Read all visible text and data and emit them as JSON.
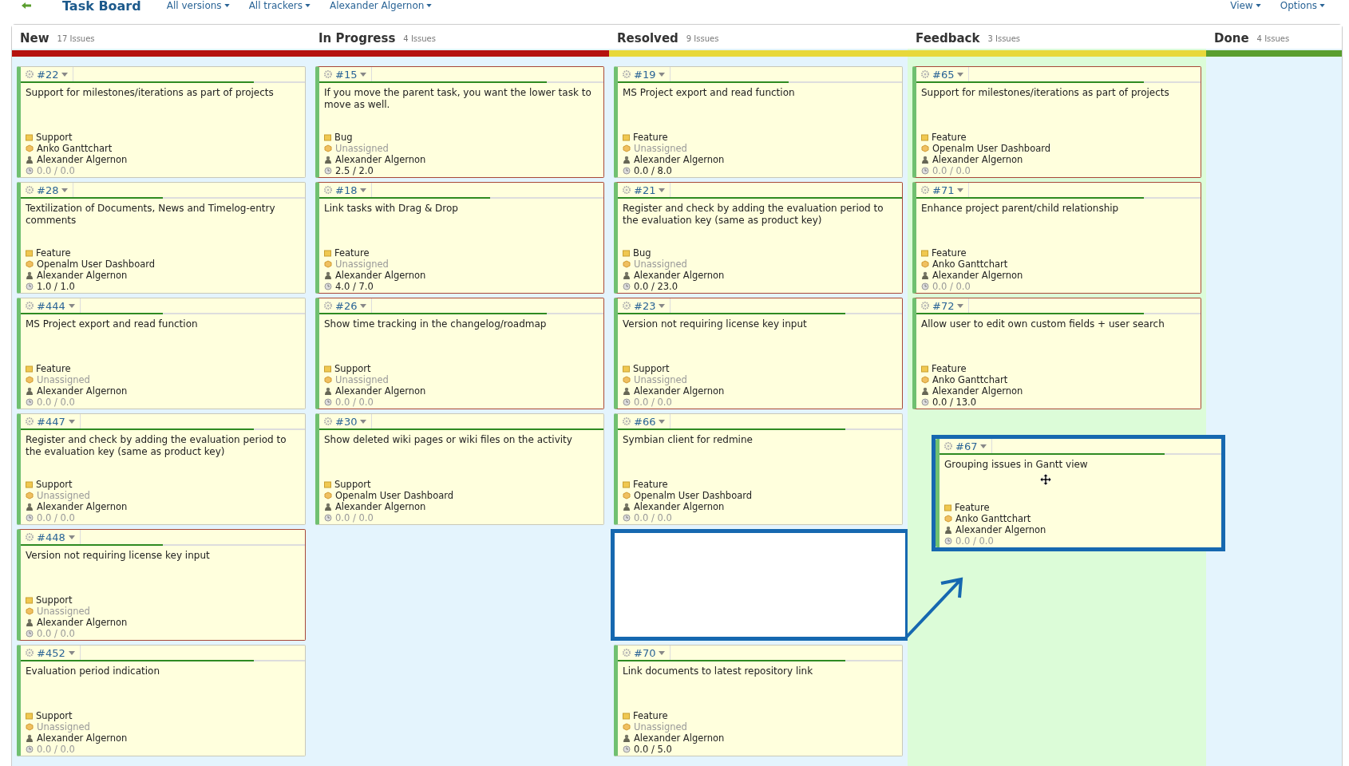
{
  "toolbar": {
    "title": "Task Board",
    "filters": [
      "All versions",
      "All trackers",
      "Alexander Algernon"
    ],
    "menus": [
      "View",
      "Options"
    ]
  },
  "columns": [
    {
      "name": "New",
      "count": "17 Issues",
      "color": "#b5130f",
      "drop_target": false,
      "cards": [
        {
          "kind": "card",
          "id": "#22",
          "level": 0.82,
          "title": "Support for milestones/iterations as part of projects",
          "tracker": "Support",
          "category": "Anko Ganttchart",
          "unassigned": false,
          "assignee": "Alexander Algernon",
          "hours": "0.0 / 0.0",
          "hours_zero": true,
          "flagged": false
        },
        {
          "kind": "card",
          "id": "#28",
          "level": 0.5,
          "title": "Textilization of Documents, News and Timelog-entry comments",
          "tracker": "Feature",
          "category": "Openalm User Dashboard",
          "unassigned": false,
          "assignee": "Alexander Algernon",
          "hours": "1.0 / 1.0",
          "hours_zero": false,
          "flagged": false
        },
        {
          "kind": "card",
          "id": "#444",
          "level": 0.5,
          "title": "MS Project export and read function",
          "tracker": "Feature",
          "category": "Unassigned",
          "unassigned": true,
          "assignee": "Alexander Algernon",
          "hours": "0.0 / 0.0",
          "hours_zero": true,
          "flagged": false
        },
        {
          "kind": "card",
          "id": "#447",
          "level": 0.82,
          "title": "Register and check by adding the evaluation period to the evaluation key (same as product key)",
          "tracker": "Support",
          "category": "Unassigned",
          "unassigned": true,
          "assignee": "Alexander Algernon",
          "hours": "0.0 / 0.0",
          "hours_zero": true,
          "flagged": false
        },
        {
          "kind": "card",
          "id": "#448",
          "level": 0.5,
          "title": "Version not requiring license key input",
          "tracker": "Support",
          "category": "Unassigned",
          "unassigned": true,
          "assignee": "Alexander Algernon",
          "hours": "0.0 / 0.0",
          "hours_zero": true,
          "flagged": true
        },
        {
          "kind": "card",
          "id": "#452",
          "level": 0.82,
          "title": "Evaluation period indication",
          "tracker": "Support",
          "category": "Unassigned",
          "unassigned": true,
          "assignee": "Alexander Algernon",
          "hours": "0.0 / 0.0",
          "hours_zero": true,
          "flagged": false
        }
      ]
    },
    {
      "name": "In Progress",
      "count": "4 Issues",
      "color": "#b5130f",
      "drop_target": false,
      "cards": [
        {
          "kind": "card",
          "id": "#15",
          "level": 0.8,
          "title": "If you move the parent task, you want the lower task to move as well.",
          "tracker": "Bug",
          "category": "Unassigned",
          "unassigned": true,
          "assignee": "Alexander Algernon",
          "hours": "2.5 / 2.0",
          "hours_zero": false,
          "flagged": true
        },
        {
          "kind": "card",
          "id": "#18",
          "level": 0.6,
          "title": "Link tasks with Drag & Drop",
          "tracker": "Feature",
          "category": "Unassigned",
          "unassigned": true,
          "assignee": "Alexander Algernon",
          "hours": "4.0 / 7.0",
          "hours_zero": false,
          "flagged": true
        },
        {
          "kind": "card",
          "id": "#26",
          "level": 0.8,
          "title": "Show time tracking in the changelog/roadmap",
          "tracker": "Support",
          "category": "Unassigned",
          "unassigned": true,
          "assignee": "Alexander Algernon",
          "hours": "0.0 / 0.0",
          "hours_zero": true,
          "flagged": true
        },
        {
          "kind": "card",
          "id": "#30",
          "level": 1.0,
          "title": "Show deleted wiki pages or wiki files on the activity",
          "tracker": "Support",
          "category": "Openalm User Dashboard",
          "unassigned": false,
          "assignee": "Alexander Algernon",
          "hours": "0.0 / 0.0",
          "hours_zero": true,
          "flagged": false
        }
      ]
    },
    {
      "name": "Resolved",
      "count": "9 Issues",
      "color": "#e8d83a",
      "drop_target": false,
      "cards": [
        {
          "kind": "card",
          "id": "#19",
          "level": 0.6,
          "title": "MS Project export and read function",
          "tracker": "Feature",
          "category": "Unassigned",
          "unassigned": true,
          "assignee": "Alexander Algernon",
          "hours": "0.0 / 8.0",
          "hours_zero": false,
          "flagged": false
        },
        {
          "kind": "card",
          "id": "#21",
          "level": 1.0,
          "title": "Register and check by adding the evaluation period to the evaluation key (same as product key)",
          "tracker": "Bug",
          "category": "Unassigned",
          "unassigned": true,
          "assignee": "Alexander Algernon",
          "hours": "0.0 / 23.0",
          "hours_zero": false,
          "flagged": true
        },
        {
          "kind": "card",
          "id": "#23",
          "level": 0.8,
          "title": "Version not requiring license key input",
          "tracker": "Support",
          "category": "Unassigned",
          "unassigned": true,
          "assignee": "Alexander Algernon",
          "hours": "0.0 / 0.0",
          "hours_zero": true,
          "flagged": true
        },
        {
          "kind": "card",
          "id": "#66",
          "level": 0.8,
          "title": "Symbian client for redmine",
          "tracker": "Feature",
          "category": "Openalm User Dashboard",
          "unassigned": false,
          "assignee": "Alexander Algernon",
          "hours": "0.0 / 0.0",
          "hours_zero": true,
          "flagged": false
        },
        {
          "kind": "placeholder"
        },
        {
          "kind": "card",
          "id": "#70",
          "level": 0.8,
          "title": "Link documents to latest repository link",
          "tracker": "Feature",
          "category": "Unassigned",
          "unassigned": true,
          "assignee": "Alexander Algernon",
          "hours": "0.0 / 5.0",
          "hours_zero": false,
          "flagged": false
        }
      ]
    },
    {
      "name": "Feedback",
      "count": "3 Issues",
      "color": "#e8d83a",
      "drop_target": true,
      "cards": [
        {
          "kind": "card",
          "id": "#65",
          "level": 0.8,
          "title": "Support for milestones/iterations as part of projects",
          "tracker": "Feature",
          "category": "Openalm User Dashboard",
          "unassigned": false,
          "assignee": "Alexander Algernon",
          "hours": "0.0 / 0.0",
          "hours_zero": true,
          "flagged": true
        },
        {
          "kind": "card",
          "id": "#71",
          "level": 0.8,
          "title": "Enhance project parent/child relationship",
          "tracker": "Feature",
          "category": "Anko Ganttchart",
          "unassigned": false,
          "assignee": "Alexander Algernon",
          "hours": "0.0 / 0.0",
          "hours_zero": true,
          "flagged": true
        },
        {
          "kind": "card",
          "id": "#72",
          "level": 0.8,
          "title": "Allow user to edit own custom fields + user search",
          "tracker": "Feature",
          "category": "Anko Ganttchart",
          "unassigned": false,
          "assignee": "Alexander Algernon",
          "hours": "0.0 / 13.0",
          "hours_zero": false,
          "flagged": true
        }
      ],
      "dragged_card": {
        "id": "#67",
        "level": 0.8,
        "title": "Grouping issues in Gantt view",
        "tracker": "Feature",
        "category": "Anko Ganttchart",
        "unassigned": false,
        "assignee": "Alexander Algernon",
        "hours": "0.0 / 0.0",
        "hours_zero": true
      }
    },
    {
      "name": "Done",
      "count": "4 Issues",
      "color": "#5a9e2e",
      "drop_target": false
    }
  ]
}
